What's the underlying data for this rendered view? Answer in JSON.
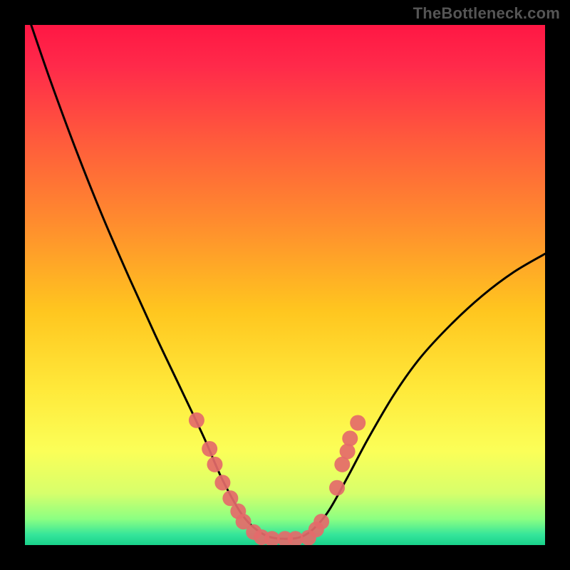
{
  "watermark": "TheBottleneck.com",
  "gradient_stops": [
    {
      "offset": 0.0,
      "color": "#ff1744"
    },
    {
      "offset": 0.08,
      "color": "#ff2a4a"
    },
    {
      "offset": 0.22,
      "color": "#ff5a3c"
    },
    {
      "offset": 0.38,
      "color": "#ff8c2e"
    },
    {
      "offset": 0.55,
      "color": "#ffc61f"
    },
    {
      "offset": 0.7,
      "color": "#ffe93a"
    },
    {
      "offset": 0.82,
      "color": "#fbff58"
    },
    {
      "offset": 0.9,
      "color": "#d7ff6b"
    },
    {
      "offset": 0.95,
      "color": "#8bff82"
    },
    {
      "offset": 0.98,
      "color": "#35e59a"
    },
    {
      "offset": 1.0,
      "color": "#19d28b"
    }
  ],
  "chart_data": {
    "type": "line",
    "title": "",
    "xlabel": "",
    "ylabel": "",
    "xlim": [
      0,
      10
    ],
    "ylim": [
      0,
      10
    ],
    "series": [
      {
        "name": "curve",
        "stroke": "#000000",
        "stroke_width": 3,
        "x": [
          0.12,
          0.5,
          1.0,
          1.5,
          2.0,
          2.5,
          3.0,
          3.45,
          3.8,
          4.2,
          4.6,
          5.0,
          5.4,
          5.8,
          6.2,
          6.6,
          7.1,
          7.6,
          8.2,
          8.8,
          9.4,
          10.0
        ],
        "y": [
          10.0,
          8.9,
          7.55,
          6.3,
          5.15,
          4.05,
          3.0,
          2.05,
          1.25,
          0.55,
          0.2,
          0.12,
          0.2,
          0.6,
          1.3,
          2.05,
          2.9,
          3.6,
          4.25,
          4.8,
          5.25,
          5.6
        ]
      }
    ],
    "points": {
      "name": "markers",
      "fill": "#e46a6a",
      "radius": 11,
      "x": [
        3.3,
        3.55,
        3.65,
        3.8,
        3.95,
        4.1,
        4.2,
        4.4,
        4.55,
        4.75,
        5.0,
        5.2,
        5.45,
        5.7,
        5.6,
        6.0,
        6.1,
        6.2,
        6.25,
        6.4
      ],
      "y": [
        2.4,
        1.85,
        1.55,
        1.2,
        0.9,
        0.65,
        0.45,
        0.25,
        0.15,
        0.12,
        0.12,
        0.12,
        0.14,
        0.45,
        0.3,
        1.1,
        1.55,
        1.8,
        2.05,
        2.35
      ]
    }
  }
}
